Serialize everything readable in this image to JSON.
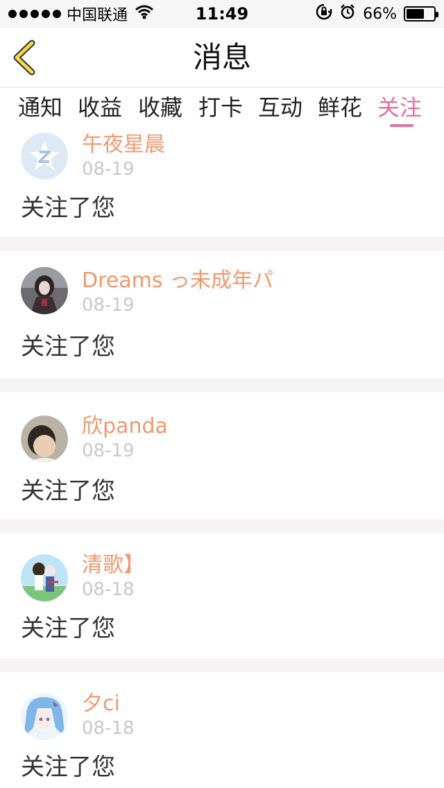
{
  "status_bar": {
    "carrier": "中国联通",
    "time": "11:49",
    "battery_percent": "66%",
    "battery_level": 0.66,
    "icons": [
      "signal-dots-icon",
      "wifi-icon",
      "rotation-lock-icon",
      "alarm-icon",
      "battery-icon"
    ]
  },
  "nav": {
    "title": "消息",
    "back_icon": "chevron-left-icon",
    "back_color": "#f5d84a"
  },
  "tabs": [
    {
      "label": "通知",
      "active": false
    },
    {
      "label": "收益",
      "active": false
    },
    {
      "label": "收藏",
      "active": false
    },
    {
      "label": "打卡",
      "active": false
    },
    {
      "label": "互动",
      "active": false
    },
    {
      "label": "鲜花",
      "active": false
    },
    {
      "label": "关注",
      "active": true
    }
  ],
  "colors": {
    "accent": "#e46fa0",
    "username": "#f0986e",
    "date": "#c8c8c8",
    "separator": "#f5f3f3"
  },
  "messages": [
    {
      "username": "午夜星晨",
      "date": "08-19",
      "text": "关注了您"
    },
    {
      "username": "Dreams っ未成年パ",
      "date": "08-19",
      "text": "关注了您"
    },
    {
      "username": "欣panda",
      "date": "08-19",
      "text": "关注了您"
    },
    {
      "username": "清歌】",
      "date": "08-18",
      "text": "关注了您"
    },
    {
      "username": "夕ci",
      "date": "08-18",
      "text": "关注了您"
    }
  ]
}
